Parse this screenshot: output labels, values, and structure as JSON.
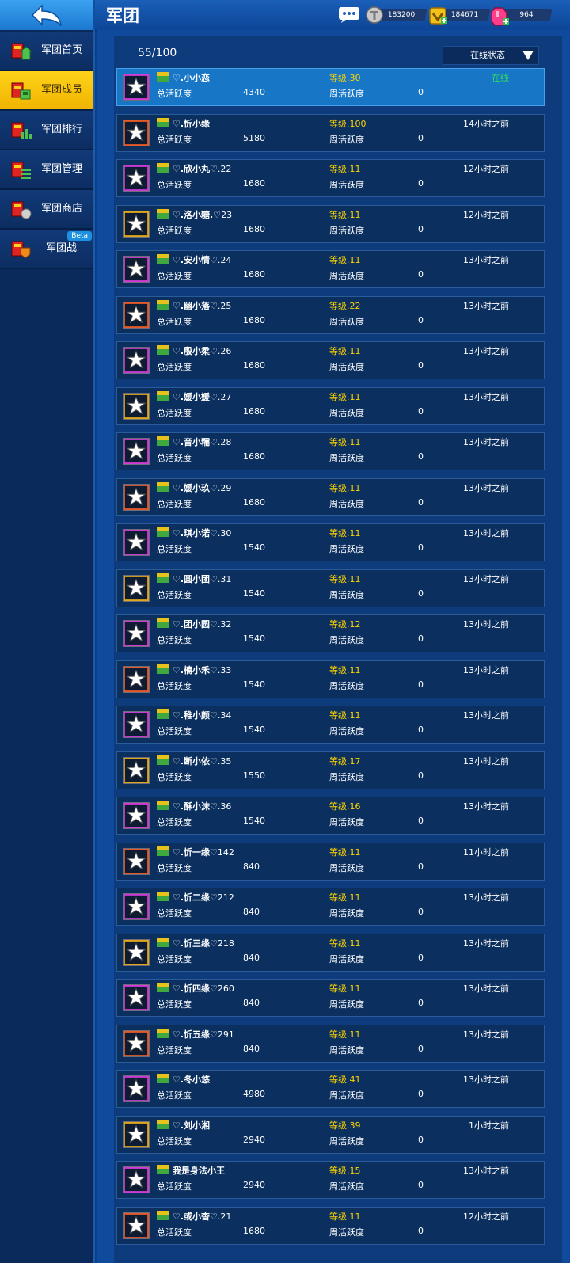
{
  "header": {
    "title": "军团",
    "resources": [
      {
        "name": "silver-coin",
        "value": "183200"
      },
      {
        "name": "gold-coin",
        "value": "184671"
      },
      {
        "name": "gem",
        "value": "964"
      }
    ]
  },
  "sidebar": {
    "items": [
      {
        "label": "军团首页",
        "icon": "legion-home-icon"
      },
      {
        "label": "军团成员",
        "icon": "legion-members-icon",
        "active": true
      },
      {
        "label": "军团排行",
        "icon": "legion-ranking-icon"
      },
      {
        "label": "军团管理",
        "icon": "legion-manage-icon"
      },
      {
        "label": "军团商店",
        "icon": "legion-shop-icon"
      },
      {
        "label": "军团战",
        "icon": "legion-war-icon",
        "badge": "Beta"
      }
    ]
  },
  "members_panel": {
    "count": "55/100",
    "status_filter": "在线状态",
    "total_label": "总活跃度",
    "week_label": "周活跃度"
  },
  "members": [
    {
      "name": "♡.小小恋",
      "suffix": "",
      "level": "等级.30",
      "total": "4340",
      "week": "0",
      "status": "在线",
      "online": true,
      "self": true
    },
    {
      "name": "♡.忻小缘",
      "suffix": "",
      "level": "等级.100",
      "total": "5180",
      "week": "0",
      "status": "14小时之前"
    },
    {
      "name": "♡.欣小丸♡",
      "suffix": ".22",
      "level": "等级.11",
      "total": "1680",
      "week": "0",
      "status": "12小时之前"
    },
    {
      "name": "♡.洛小糖.♡",
      "suffix": "23",
      "level": "等级.11",
      "total": "1680",
      "week": "0",
      "status": "12小时之前"
    },
    {
      "name": "♡.安小情♡",
      "suffix": ".24",
      "level": "等级.11",
      "total": "1680",
      "week": "0",
      "status": "13小时之前"
    },
    {
      "name": "♡.幽小落♡",
      "suffix": ".25",
      "level": "等级.22",
      "total": "1680",
      "week": "0",
      "status": "13小时之前"
    },
    {
      "name": "♡.殷小柔♡",
      "suffix": ".26",
      "level": "等级.11",
      "total": "1680",
      "week": "0",
      "status": "13小时之前"
    },
    {
      "name": "♡.媛小媛♡",
      "suffix": ".27",
      "level": "等级.11",
      "total": "1680",
      "week": "0",
      "status": "13小时之前"
    },
    {
      "name": "♡.音小糯♡",
      "suffix": ".28",
      "level": "等级.11",
      "total": "1680",
      "week": "0",
      "status": "13小时之前"
    },
    {
      "name": "♡.媛小玖♡",
      "suffix": ".29",
      "level": "等级.11",
      "total": "1680",
      "week": "0",
      "status": "13小时之前"
    },
    {
      "name": "♡.琪小诺♡",
      "suffix": ".30",
      "level": "等级.11",
      "total": "1540",
      "week": "0",
      "status": "13小时之前"
    },
    {
      "name": "♡.圆小团♡",
      "suffix": ".31",
      "level": "等级.11",
      "total": "1540",
      "week": "0",
      "status": "13小时之前"
    },
    {
      "name": "♡.团小圆♡",
      "suffix": ".32",
      "level": "等级.12",
      "total": "1540",
      "week": "0",
      "status": "13小时之前"
    },
    {
      "name": "♡.楠小禾♡",
      "suffix": ".33",
      "level": "等级.11",
      "total": "1540",
      "week": "0",
      "status": "13小时之前"
    },
    {
      "name": "♡.稚小颜♡",
      "suffix": ".34",
      "level": "等级.11",
      "total": "1540",
      "week": "0",
      "status": "13小时之前"
    },
    {
      "name": "♡.断小依♡",
      "suffix": ".35",
      "level": "等级.17",
      "total": "1550",
      "week": "0",
      "status": "13小时之前"
    },
    {
      "name": "♡.酥小沫♡",
      "suffix": ".36",
      "level": "等级.16",
      "total": "1540",
      "week": "0",
      "status": "13小时之前"
    },
    {
      "name": "♡.忻一缘♡",
      "suffix": "142",
      "level": "等级.11",
      "total": "840",
      "week": "0",
      "status": "11小时之前"
    },
    {
      "name": "♡.忻二缘♡",
      "suffix": "212",
      "level": "等级.11",
      "total": "840",
      "week": "0",
      "status": "13小时之前"
    },
    {
      "name": "♡.忻三缘♡",
      "suffix": "218",
      "level": "等级.11",
      "total": "840",
      "week": "0",
      "status": "13小时之前"
    },
    {
      "name": "♡.忻四缘♡",
      "suffix": "260",
      "level": "等级.11",
      "total": "840",
      "week": "0",
      "status": "13小时之前"
    },
    {
      "name": "♡.忻五缘♡",
      "suffix": "291",
      "level": "等级.11",
      "total": "840",
      "week": "0",
      "status": "13小时之前"
    },
    {
      "name": "♡.冬小悠",
      "suffix": "",
      "level": "等级.41",
      "total": "4980",
      "week": "0",
      "status": "13小时之前"
    },
    {
      "name": "♡.刘小湘",
      "suffix": "",
      "level": "等级.39",
      "total": "2940",
      "week": "0",
      "status": "1小时之前"
    },
    {
      "name": "我是身法小王",
      "suffix": "",
      "level": "等级.15",
      "total": "2940",
      "week": "0",
      "status": "13小时之前"
    },
    {
      "name": "♡.或小杳♡",
      "suffix": ".21",
      "level": "等级.11",
      "total": "1680",
      "week": "0",
      "status": "12小时之前"
    }
  ],
  "colors": {
    "accent_yellow": "#ffd400",
    "online_green": "#2ee05a",
    "row_bg": "#0b2f5e",
    "self_row_bg": "#1876c7"
  }
}
